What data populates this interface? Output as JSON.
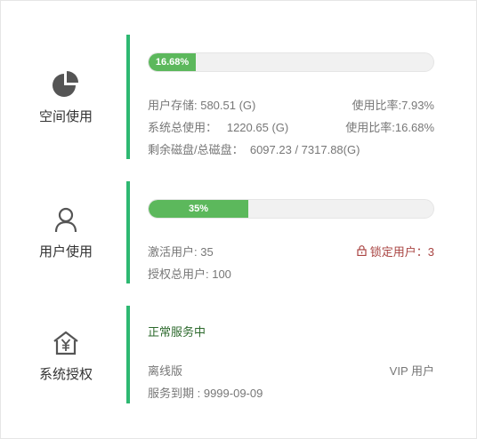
{
  "storage": {
    "title": "空间使用",
    "icon": "pie-chart-icon",
    "progress_label": "16.68%",
    "progress_fraction": 0.1668,
    "user_storage": "用户存储: 580.51 (G)",
    "user_ratio": "使用比率:7.93%",
    "system_used": "系统总使用：   1220.65 (G)",
    "system_ratio": "使用比率:16.68%",
    "disk": "剩余磁盘/总磁盘：  6097.23 / 7317.88(G)"
  },
  "users": {
    "title": "用户使用",
    "icon": "user-icon",
    "progress_label": "35%",
    "progress_fraction": 0.35,
    "active": "激活用户: 35",
    "locked": "锁定用户：3",
    "authorized": "授权总用户: 100"
  },
  "license": {
    "title": "系统授权",
    "icon": "yen-house-icon",
    "status": "正常服务中",
    "edition": "离线版",
    "level": "VIP 用户",
    "expire": "服务到期 : 9999-09-09"
  },
  "colors": {
    "accent": "#2eb872",
    "progress": "#5cb85c",
    "locked": "#a94442",
    "status": "#2d6a2d"
  }
}
